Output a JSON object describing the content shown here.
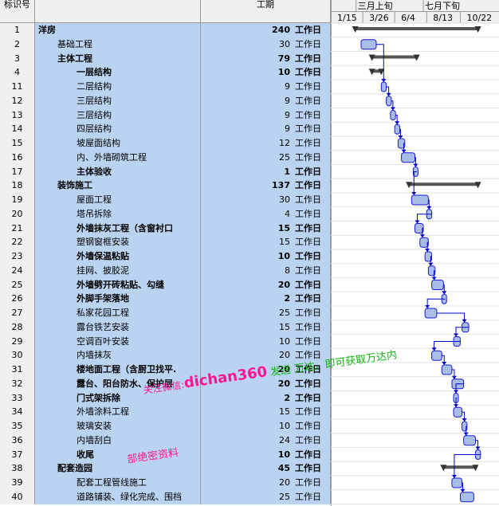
{
  "header": {
    "id_label": "标识号",
    "duration_label": "工期",
    "timescale_top": [
      "三月上旬",
      "七月下旬"
    ],
    "timescale_bottom": [
      "1/15",
      "3/26",
      "6/4",
      "8/13",
      "10/22"
    ]
  },
  "tasks": [
    {
      "id": "1",
      "name": "洋房",
      "dur": "240",
      "unit": "工作日",
      "level": 0,
      "bold": true
    },
    {
      "id": "2",
      "name": "基础工程",
      "dur": "30",
      "unit": "工作日",
      "level": 1,
      "bold": false
    },
    {
      "id": "3",
      "name": "主体工程",
      "dur": "79",
      "unit": "工作日",
      "level": 1,
      "bold": true
    },
    {
      "id": "4",
      "name": "一层结构",
      "dur": "10",
      "unit": "工作日",
      "level": 2,
      "bold": true
    },
    {
      "id": "11",
      "name": "二层结构",
      "dur": "9",
      "unit": "工作日",
      "level": 2,
      "bold": false
    },
    {
      "id": "12",
      "name": "三层结构",
      "dur": "9",
      "unit": "工作日",
      "level": 2,
      "bold": false
    },
    {
      "id": "13",
      "name": "三层结构",
      "dur": "9",
      "unit": "工作日",
      "level": 2,
      "bold": false
    },
    {
      "id": "14",
      "name": "四层结构",
      "dur": "9",
      "unit": "工作日",
      "level": 2,
      "bold": false
    },
    {
      "id": "15",
      "name": "坡屋面结构",
      "dur": "12",
      "unit": "工作日",
      "level": 2,
      "bold": false
    },
    {
      "id": "16",
      "name": "内、外墙砌筑工程",
      "dur": "25",
      "unit": "工作日",
      "level": 2,
      "bold": false
    },
    {
      "id": "17",
      "name": "主体验收",
      "dur": "1",
      "unit": "工作日",
      "level": 2,
      "bold": true
    },
    {
      "id": "18",
      "name": "装饰施工",
      "dur": "137",
      "unit": "工作日",
      "level": 1,
      "bold": true
    },
    {
      "id": "19",
      "name": "屋面工程",
      "dur": "30",
      "unit": "工作日",
      "level": 2,
      "bold": false
    },
    {
      "id": "20",
      "name": "塔吊拆除",
      "dur": "4",
      "unit": "工作日",
      "level": 2,
      "bold": false
    },
    {
      "id": "21",
      "name": "外墙抹灰工程（含窗衬口",
      "dur": "15",
      "unit": "工作日",
      "level": 2,
      "bold": true
    },
    {
      "id": "22",
      "name": "塑钢窗框安装",
      "dur": "15",
      "unit": "工作日",
      "level": 2,
      "bold": false
    },
    {
      "id": "23",
      "name": "外墙保温粘贴",
      "dur": "10",
      "unit": "工作日",
      "level": 2,
      "bold": true
    },
    {
      "id": "24",
      "name": "挂网、披胶泥",
      "dur": "8",
      "unit": "工作日",
      "level": 2,
      "bold": false
    },
    {
      "id": "25",
      "name": "外墙劈开砖粘贴、勾缝",
      "dur": "20",
      "unit": "工作日",
      "level": 2,
      "bold": true
    },
    {
      "id": "26",
      "name": "外脚手架落地",
      "dur": "2",
      "unit": "工作日",
      "level": 2,
      "bold": true
    },
    {
      "id": "27",
      "name": "私家花园工程",
      "dur": "25",
      "unit": "工作日",
      "level": 2,
      "bold": false
    },
    {
      "id": "28",
      "name": "露台铁艺安装",
      "dur": "15",
      "unit": "工作日",
      "level": 2,
      "bold": false
    },
    {
      "id": "29",
      "name": "空调百叶安装",
      "dur": "10",
      "unit": "工作日",
      "level": 2,
      "bold": false
    },
    {
      "id": "30",
      "name": "内墙抹灰",
      "dur": "20",
      "unit": "工作日",
      "level": 2,
      "bold": false
    },
    {
      "id": "31",
      "name": "楼地面工程（含厨卫找平.",
      "dur": "20",
      "unit": "工作日",
      "level": 2,
      "bold": true
    },
    {
      "id": "32",
      "name": "露台、阳台防水、保护层",
      "dur": "20",
      "unit": "工作日",
      "level": 2,
      "bold": true
    },
    {
      "id": "33",
      "name": "门式架拆除",
      "dur": "2",
      "unit": "工作日",
      "level": 2,
      "bold": true
    },
    {
      "id": "34",
      "name": "外墙涂料工程",
      "dur": "15",
      "unit": "工作日",
      "level": 2,
      "bold": false
    },
    {
      "id": "35",
      "name": "玻璃安装",
      "dur": "10",
      "unit": "工作日",
      "level": 2,
      "bold": false
    },
    {
      "id": "36",
      "name": "内墙刮白",
      "dur": "24",
      "unit": "工作日",
      "level": 2,
      "bold": false
    },
    {
      "id": "37",
      "name": "收尾",
      "dur": "10",
      "unit": "工作日",
      "level": 2,
      "bold": true
    },
    {
      "id": "38",
      "name": "配套造园",
      "dur": "45",
      "unit": "工作日",
      "level": 1,
      "bold": true
    },
    {
      "id": "39",
      "name": "配套工程管线施工",
      "dur": "20",
      "unit": "工作日",
      "level": 2,
      "bold": false
    },
    {
      "id": "40",
      "name": "道路铺装、绿化完成、围档",
      "dur": "25",
      "unit": "工作日",
      "level": 2,
      "bold": false
    }
  ],
  "gantt_bars": [
    {
      "row": 0,
      "type": "summary",
      "start": 0.145,
      "end": 0.875
    },
    {
      "row": 1,
      "type": "task",
      "start": 0.18,
      "end": 0.27
    },
    {
      "row": 2,
      "type": "summary",
      "start": 0.245,
      "end": 0.51
    },
    {
      "row": 3,
      "type": "summary",
      "start": 0.245,
      "end": 0.3
    },
    {
      "row": 4,
      "type": "task",
      "start": 0.3,
      "end": 0.33
    },
    {
      "row": 5,
      "type": "task",
      "start": 0.33,
      "end": 0.36
    },
    {
      "row": 6,
      "type": "task",
      "start": 0.355,
      "end": 0.385
    },
    {
      "row": 7,
      "type": "task",
      "start": 0.38,
      "end": 0.41
    },
    {
      "row": 8,
      "type": "task",
      "start": 0.4,
      "end": 0.44
    },
    {
      "row": 9,
      "type": "task",
      "start": 0.42,
      "end": 0.5
    },
    {
      "row": 10,
      "type": "task",
      "start": 0.49,
      "end": 0.51
    },
    {
      "row": 11,
      "type": "summary",
      "start": 0.465,
      "end": 0.875
    },
    {
      "row": 12,
      "type": "task",
      "start": 0.48,
      "end": 0.58
    },
    {
      "row": 13,
      "type": "task",
      "start": 0.57,
      "end": 0.6
    },
    {
      "row": 14,
      "type": "task",
      "start": 0.5,
      "end": 0.55
    },
    {
      "row": 15,
      "type": "task",
      "start": 0.53,
      "end": 0.58
    },
    {
      "row": 16,
      "type": "task",
      "start": 0.56,
      "end": 0.6
    },
    {
      "row": 17,
      "type": "task",
      "start": 0.58,
      "end": 0.62
    },
    {
      "row": 18,
      "type": "task",
      "start": 0.6,
      "end": 0.67
    },
    {
      "row": 19,
      "type": "task",
      "start": 0.66,
      "end": 0.68
    },
    {
      "row": 20,
      "type": "task",
      "start": 0.56,
      "end": 0.63
    },
    {
      "row": 21,
      "type": "task",
      "start": 0.78,
      "end": 0.82
    },
    {
      "row": 22,
      "type": "task",
      "start": 0.73,
      "end": 0.77
    },
    {
      "row": 23,
      "type": "task",
      "start": 0.6,
      "end": 0.66
    },
    {
      "row": 24,
      "type": "task",
      "start": 0.66,
      "end": 0.72
    },
    {
      "row": 25,
      "type": "task",
      "start": 0.72,
      "end": 0.79
    },
    {
      "row": 26,
      "type": "task",
      "start": 0.73,
      "end": 0.75
    },
    {
      "row": 27,
      "type": "task",
      "start": 0.73,
      "end": 0.78
    },
    {
      "row": 28,
      "type": "task",
      "start": 0.78,
      "end": 0.81
    },
    {
      "row": 29,
      "type": "task",
      "start": 0.79,
      "end": 0.86
    },
    {
      "row": 30,
      "type": "task",
      "start": 0.86,
      "end": 0.89
    },
    {
      "row": 31,
      "type": "summary",
      "start": 0.67,
      "end": 0.86
    },
    {
      "row": 32,
      "type": "task",
      "start": 0.72,
      "end": 0.78
    },
    {
      "row": 33,
      "type": "task",
      "start": 0.77,
      "end": 0.85
    }
  ],
  "watermark": {
    "line1_prefix": "关注微信:",
    "line1_brand": "dichan360",
    "line1_suffix": "发送 万达，即可获取万达内",
    "line2": "部绝密资料"
  },
  "colors": {
    "row_bg": "#b9d3f0",
    "header_bg": "#f0f0f0",
    "task_bar": "#a8bde8",
    "task_border": "#1a1ad8",
    "summary_bar": "#555555",
    "link": "#0000cc",
    "watermark_pink": "#ff1493",
    "watermark_green": "#13b513"
  }
}
